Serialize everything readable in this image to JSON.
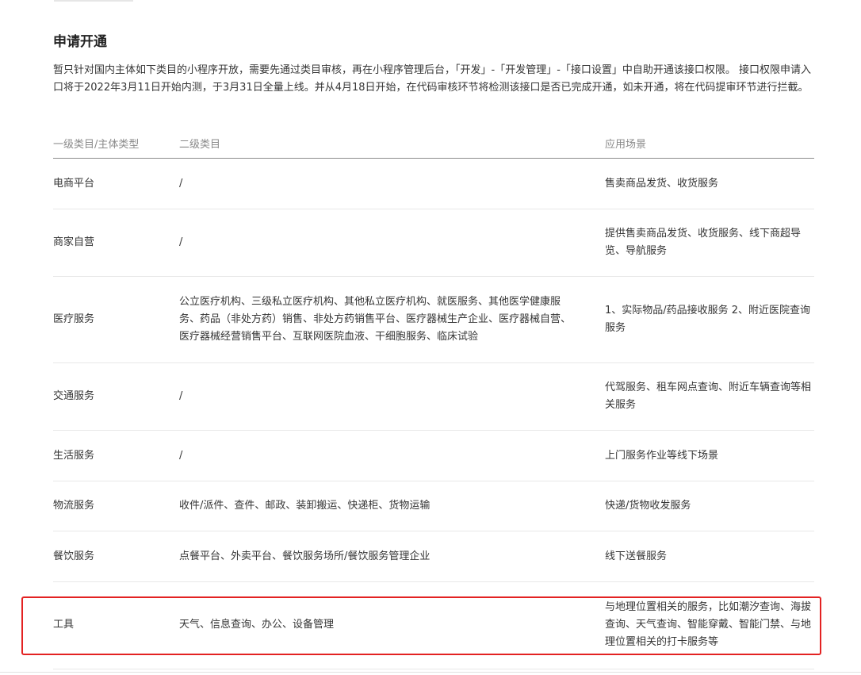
{
  "section": {
    "title": "申请开通",
    "description": "暂只针对国内主体如下类目的小程序开放，需要先通过类目审核，再在小程序管理后台，「开发」-「开发管理」-「接口设置」中自助开通该接口权限。 接口权限申请入口将于2022年3月11日开始内测，于3月31日全量上线。并从4月18日开始，在代码审核环节将检测该接口是否已完成开通，如未开通，将在代码提审环节进行拦截。"
  },
  "table": {
    "headers": [
      "一级类目/主体类型",
      "二级类目",
      "应用场景"
    ],
    "rows": [
      {
        "primary": "电商平台",
        "secondary": "/",
        "scenario": "售卖商品发货、收货服务"
      },
      {
        "primary": "商家自营",
        "secondary": "/",
        "scenario": "提供售卖商品发货、收货服务、线下商超导览、导航服务"
      },
      {
        "primary": "医疗服务",
        "secondary": "公立医疗机构、三级私立医疗机构、其他私立医疗机构、就医服务、其他医学健康服务、药品（非处方药）销售、非处方药销售平台、医疗器械生产企业、医疗器械自营、医疗器械经营销售平台、互联网医院血液、干细胞服务、临床试验",
        "scenario": "1、实际物品/药品接收服务 2、附近医院查询服务"
      },
      {
        "primary": "交通服务",
        "secondary": "/",
        "scenario": "代驾服务、租车网点查询、附近车辆查询等相关服务"
      },
      {
        "primary": "生活服务",
        "secondary": "/",
        "scenario": "上门服务作业等线下场景"
      },
      {
        "primary": "物流服务",
        "secondary": "收件/派件、查件、邮政、装卸搬运、快递柜、货物运输",
        "scenario": "快递/货物收发服务"
      },
      {
        "primary": "餐饮服务",
        "secondary": "点餐平台、外卖平台、餐饮服务场所/餐饮服务管理企业",
        "scenario": "线下送餐服务"
      },
      {
        "primary": "工具",
        "secondary": "天气、信息查询、办公、设备管理",
        "scenario": "与地理位置相关的服务，比如潮汐查询、海拔查询、天气查询、智能穿戴、智能门禁、与地理位置相关的打卡服务等"
      }
    ]
  },
  "colors": {
    "highlight_border": "#e32222",
    "header_text": "#8a8a8a",
    "body_text": "#353535"
  }
}
